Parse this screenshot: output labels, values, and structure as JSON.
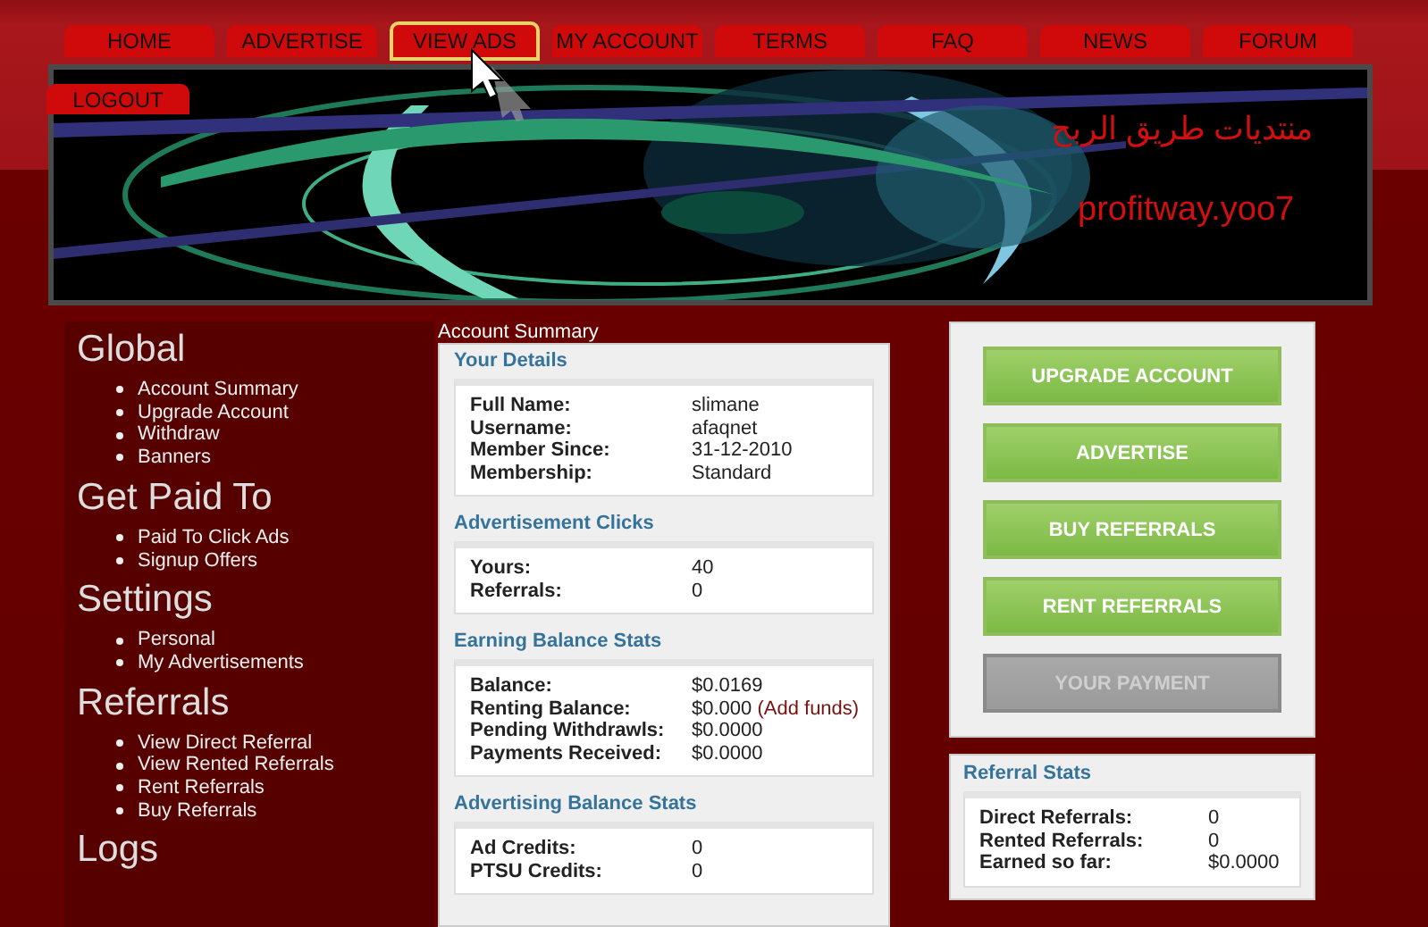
{
  "nav": [
    {
      "label": "HOME",
      "highlighted": false
    },
    {
      "label": "ADVERTISE",
      "highlighted": false
    },
    {
      "label": "VIEW ADS",
      "highlighted": true
    },
    {
      "label": "MY ACCOUNT",
      "highlighted": false
    },
    {
      "label": "TERMS",
      "highlighted": false
    },
    {
      "label": "FAQ",
      "highlighted": false
    },
    {
      "label": "NEWS",
      "highlighted": false
    },
    {
      "label": "FORUM",
      "highlighted": false
    }
  ],
  "logout": "LOGOUT",
  "banner": {
    "title": "منتديات طريق الربح",
    "subtitle": "profitway.yoo7"
  },
  "sidebar": [
    {
      "heading": "Global",
      "items": [
        "Account Summary",
        "Upgrade Account",
        "Withdraw",
        "Banners"
      ]
    },
    {
      "heading": "Get Paid To",
      "items": [
        "Paid To Click Ads",
        "Signup Offers"
      ]
    },
    {
      "heading": "Settings",
      "items": [
        "Personal",
        "My Advertisements"
      ]
    },
    {
      "heading": "Referrals",
      "items": [
        "View Direct Referral",
        "View Rented Referrals",
        "Rent Referrals",
        "Buy Referrals"
      ]
    },
    {
      "heading": "Logs"
    }
  ],
  "main": {
    "breadcrumb": "Account Summary",
    "sections": [
      {
        "title": "Your Details",
        "rows": [
          {
            "label": "Full Name:",
            "value": "slimane"
          },
          {
            "label": "Username:",
            "value": "afaqnet"
          },
          {
            "label": "Member Since:",
            "value": "31-12-2010"
          },
          {
            "label": "Membership:",
            "value": "Standard"
          }
        ]
      },
      {
        "title": "Advertisement Clicks",
        "rows": [
          {
            "label": "Yours:",
            "value": "40"
          },
          {
            "label": "Referrals:",
            "value": "0"
          }
        ]
      },
      {
        "title": "Earning Balance Stats",
        "rows": [
          {
            "label": "Balance:",
            "value": "$0.0169"
          },
          {
            "label": "Renting Balance:",
            "value": "$0.000",
            "link": "(Add funds)"
          },
          {
            "label": "Pending Withdrawls:",
            "value": "$0.0000"
          },
          {
            "label": "Payments Received:",
            "value": "$0.0000"
          }
        ]
      },
      {
        "title": "Advertising Balance Stats",
        "rows": [
          {
            "label": "Ad Credits:",
            "value": "0"
          },
          {
            "label": "PTSU Credits:",
            "value": "0"
          }
        ]
      }
    ]
  },
  "actions": [
    {
      "label": "UPGRADE ACCOUNT",
      "disabled": false
    },
    {
      "label": "ADVERTISE",
      "disabled": false
    },
    {
      "label": "BUY REFERRALS",
      "disabled": false
    },
    {
      "label": "RENT REFERRALS",
      "disabled": false
    },
    {
      "label": "YOUR PAYMENT",
      "disabled": true
    }
  ],
  "referral_stats": {
    "title": "Referral Stats",
    "rows": [
      {
        "label": "Direct Referrals:",
        "value": "0"
      },
      {
        "label": "Rented Referrals:",
        "value": "0"
      },
      {
        "label": "Earned so far:",
        "value": "$0.0000"
      }
    ]
  }
}
